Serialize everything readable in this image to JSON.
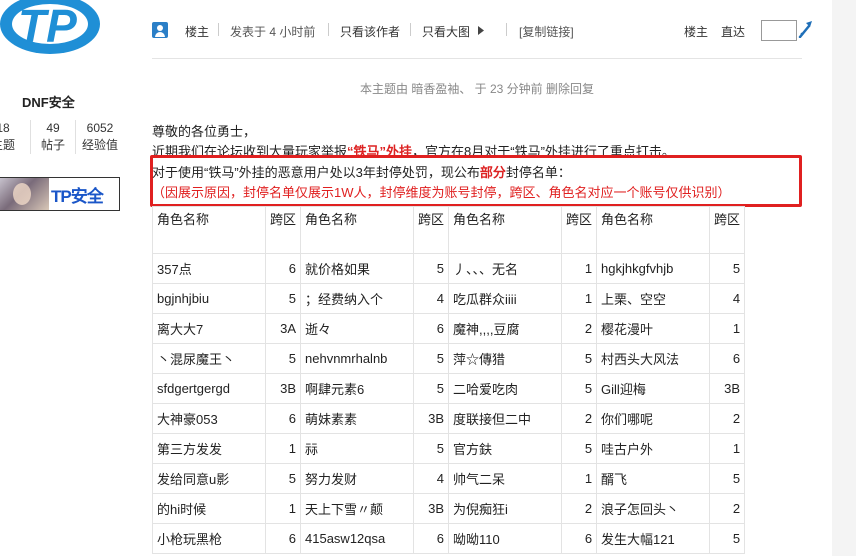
{
  "sidebar": {
    "logo_text": "TP",
    "username": "DNF安全",
    "stats": [
      {
        "value": "18",
        "label": "主题"
      },
      {
        "value": "49",
        "label": "帖子"
      },
      {
        "value": "6052",
        "label": "经验值"
      }
    ],
    "badge_text": "TP安全"
  },
  "post_header": {
    "author_label": "楼主",
    "posted_time": "发表于 4 小时前",
    "only_author": "只看该作者",
    "only_big_image": "只看大图",
    "copy_link": "[复制链接]",
    "floor_label": "楼主",
    "goto_label": "直达",
    "goto_value": ""
  },
  "mod_note": "本主题由 暗香盈袖、 于 23 分钟前 删除回复",
  "body": {
    "greeting": "尊敬的各位勇士，",
    "line2_pre": "近期我们在论坛收到大量玩家举报",
    "line2_emph": "“铁马”外挂",
    "line2_post": "，官方在8月对于“铁马”外挂进行了重点打击。",
    "line3_pre": "对于使用“铁马”外挂的恶意用户处以3年封停处罚，现公布",
    "line3_emph": "部分",
    "line3_post": "封停名单：",
    "line4": "（因展示原因，封停名单仅展示1W人，封停维度为账号封停，跨区、角色名对应一个账号仅供识别）"
  },
  "table": {
    "headers": [
      "角色名称",
      "跨区",
      "角色名称",
      "跨区",
      "角色名称",
      "跨区",
      "角色名称",
      "跨区"
    ],
    "rows": [
      [
        "357点",
        "6",
        "就价格如果",
        "5",
        "丿、、、无名",
        "1",
        "hgkjhkgfvhjb",
        "5"
      ],
      [
        "bgjnhjbiu",
        "5",
        "；经费纳入个",
        "4",
        "吃瓜群众iiii",
        "1",
        "上栗、空空",
        "4"
      ],
      [
        "离大大7",
        "3A",
        "逝々",
        "6",
        "魔神,,,,豆腐",
        "2",
        "樱花漫叶",
        "1"
      ],
      [
        "丶混尿魔王丶",
        "5",
        "nehvnmrhalnb",
        "5",
        "萍☆傳猎",
        "5",
        "村西头大风法",
        "6"
      ],
      [
        "sfdgertgergd",
        "3B",
        "啊肆元素6",
        "5",
        "二哈爱吃肉",
        "5",
        "Gill迎梅",
        "3B"
      ],
      [
        "大神豪053",
        "6",
        "萌妹素素",
        "3B",
        "度联接但二中",
        "2",
        "你们哪呢",
        "2"
      ],
      [
        "第三方发发",
        "1",
        "祘",
        "5",
        "官方鈇",
        "5",
        "哇古户外",
        "1"
      ],
      [
        "发给同意u影",
        "5",
        "努力发财",
        "4",
        "帅气二呆",
        "1",
        "醑飞",
        "5"
      ],
      [
        "的hi时候",
        "1",
        "天上下雪〃颠",
        "3B",
        "为倪痴狂i",
        "2",
        "浪子怎回头丶",
        "2"
      ],
      [
        "小枪玩黑枪",
        "6",
        "415asw12qsa",
        "6",
        "呦呦110",
        "6",
        "发生大幅121",
        "5"
      ]
    ]
  }
}
